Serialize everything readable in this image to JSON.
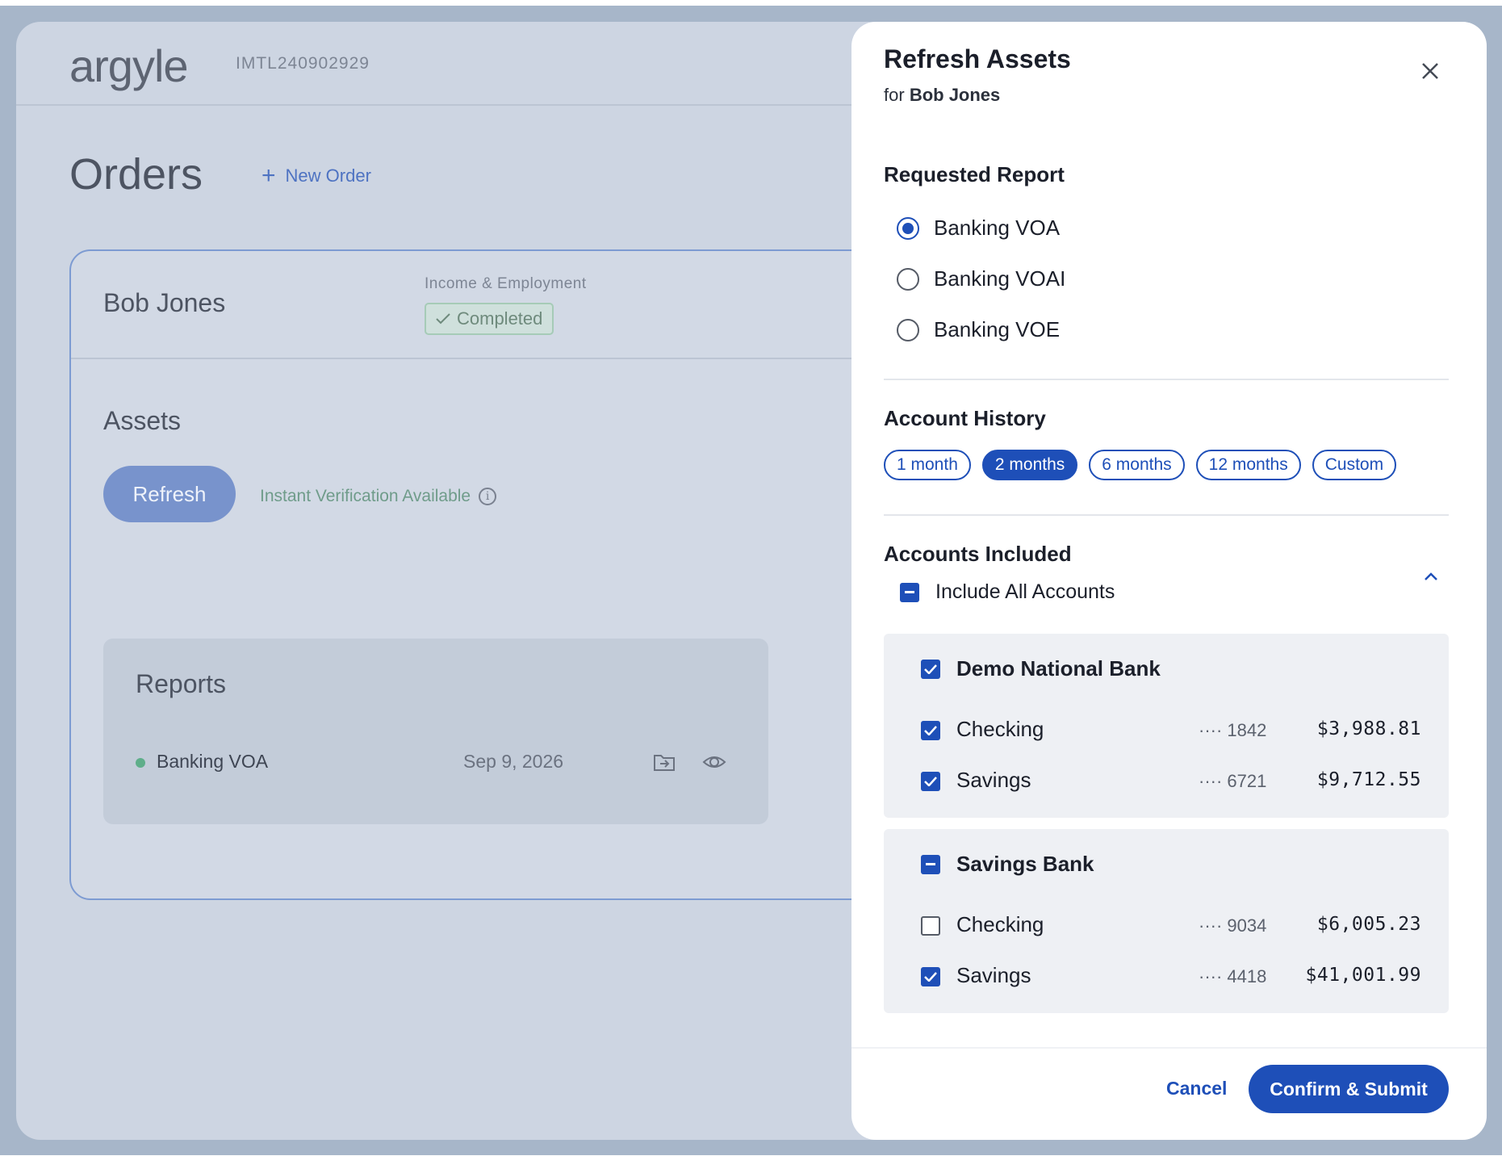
{
  "app": {
    "logo": "argyle",
    "order_id": "IMTL240902929",
    "page_title": "Orders",
    "new_order_label": "New Order"
  },
  "order_card": {
    "person_name": "Bob Jones",
    "category_label": "Income & Employment",
    "status": "Completed",
    "assets_title": "Assets",
    "refresh_label": "Refresh",
    "instant_label": "Instant Verification Available",
    "reports_title": "Reports",
    "report": {
      "name": "Banking VOA",
      "date": "Sep 9, 2026"
    }
  },
  "panel": {
    "title": "Refresh Assets",
    "subtitle_prefix": "for",
    "subtitle_name": "Bob Jones",
    "requested_report_title": "Requested Report",
    "report_options": [
      {
        "label": "Banking VOA",
        "selected": true
      },
      {
        "label": "Banking VOAI",
        "selected": false
      },
      {
        "label": "Banking VOE",
        "selected": false
      }
    ],
    "account_history_title": "Account History",
    "history_options": [
      {
        "label": "1 month",
        "selected": false
      },
      {
        "label": "2 months",
        "selected": true
      },
      {
        "label": "6 months",
        "selected": false
      },
      {
        "label": "12 months",
        "selected": false
      },
      {
        "label": "Custom",
        "selected": false
      }
    ],
    "accounts_included_title": "Accounts Included",
    "include_all_label": "Include All Accounts",
    "banks": [
      {
        "name": "Demo National Bank",
        "state": "checked",
        "accounts": [
          {
            "name": "Checking",
            "mask": "···· 1842",
            "balance": "$3,988.81",
            "checked": true
          },
          {
            "name": "Savings",
            "mask": "···· 6721",
            "balance": "$9,712.55",
            "checked": true
          }
        ]
      },
      {
        "name": "Savings Bank",
        "state": "mixed",
        "accounts": [
          {
            "name": "Checking",
            "mask": "···· 9034",
            "balance": "$6,005.23",
            "checked": false
          },
          {
            "name": "Savings",
            "mask": "···· 4418",
            "balance": "$41,001.99",
            "checked": true
          }
        ]
      }
    ],
    "cancel_label": "Cancel",
    "confirm_label": "Confirm & Submit"
  },
  "colors": {
    "accent": "#1e4fb8",
    "overlay_bg": "#cdd5e2",
    "success": "#5fae8a"
  },
  "icons": [
    "plus-icon",
    "check-icon",
    "info-icon",
    "export-icon",
    "eye-icon",
    "close-icon",
    "chevron-up-icon"
  ]
}
